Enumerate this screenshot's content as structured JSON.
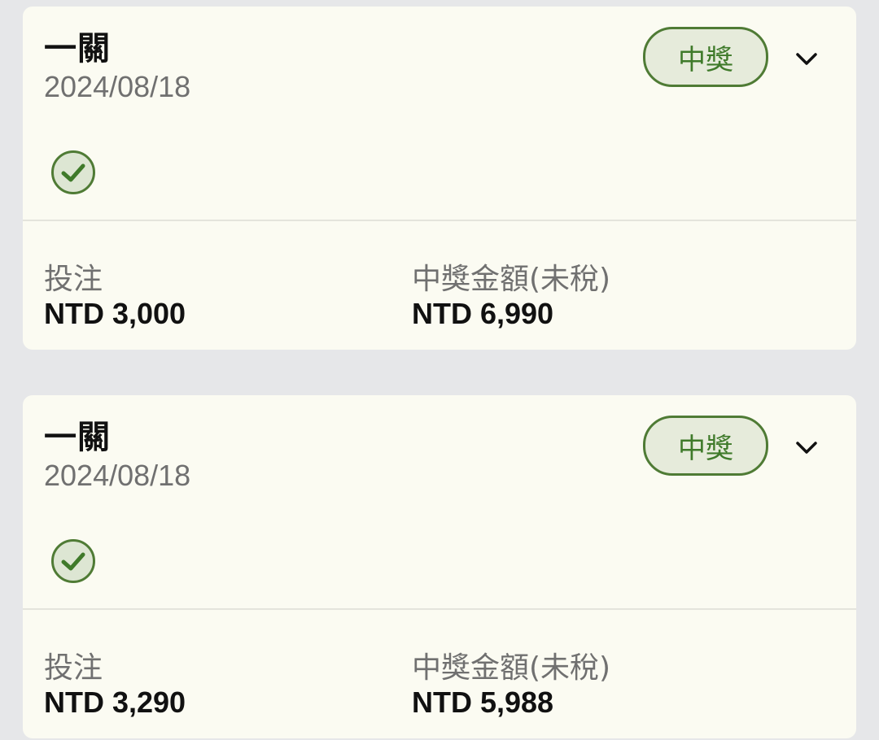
{
  "cards": [
    {
      "title": "一關",
      "date": "2024/08/18",
      "status": "中獎",
      "stake_label": "投注",
      "stake_value": "NTD 3,000",
      "payout_label": "中獎金額(未稅)",
      "payout_value": "NTD 6,990"
    },
    {
      "title": "一關",
      "date": "2024/08/18",
      "status": "中獎",
      "stake_label": "投注",
      "stake_value": "NTD 3,290",
      "payout_label": "中獎金額(未稅)",
      "payout_value": "NTD 5,988"
    }
  ],
  "colors": {
    "accent_green": "#4f7b35",
    "badge_bg": "#e6ebdb",
    "card_bg": "#fbfbf2",
    "page_bg": "#e6e7e9"
  },
  "icons": {
    "expand": "chevron-down-icon",
    "result": "check-circle-icon"
  }
}
